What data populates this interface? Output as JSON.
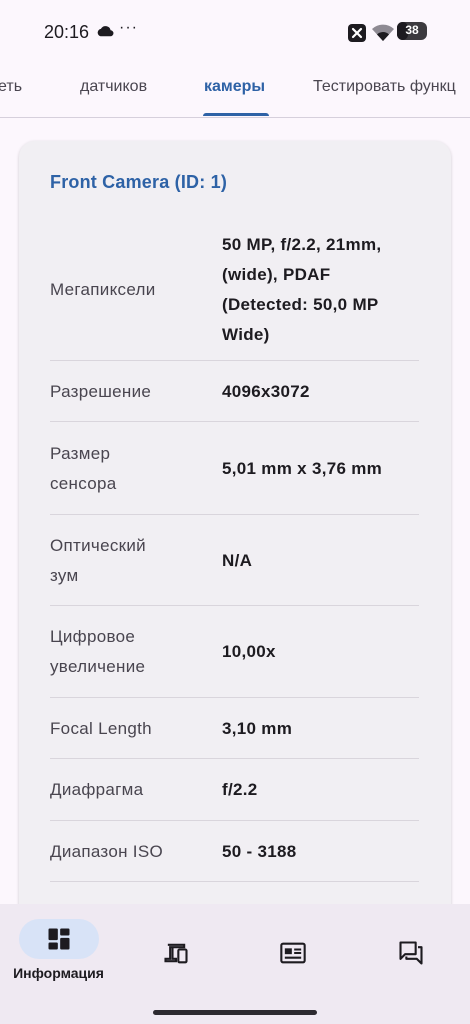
{
  "status_bar": {
    "time": "20:16",
    "dots": "···",
    "battery": "38",
    "battery_level": 0.38,
    "icons": [
      "cloud-icon",
      "notification-x-icon",
      "wifi-icon",
      "battery-icon"
    ]
  },
  "tabs": [
    {
      "label": "еть",
      "active": false
    },
    {
      "label": "датчиков",
      "active": false
    },
    {
      "label": "камеры",
      "active": true
    },
    {
      "label": "Тестировать функц",
      "active": false
    }
  ],
  "card": {
    "title": "Front Camera (ID: 1)",
    "rows": [
      {
        "label": [
          "Мегапиксели"
        ],
        "value": [
          "50 MP, f/2.2, 21mm,",
          "(wide), PDAF",
          "(Detected: 50,0 MP",
          "Wide)"
        ]
      },
      {
        "label": [
          "Разрешение"
        ],
        "value": [
          "4096x3072"
        ]
      },
      {
        "label": [
          "Размер",
          "сенсора"
        ],
        "value": [
          "5,01 mm x 3,76 mm"
        ]
      },
      {
        "label": [
          "Оптический",
          "зум"
        ],
        "value": [
          "N/A"
        ]
      },
      {
        "label": [
          "Цифровое",
          "увеличение"
        ],
        "value": [
          "10,00x"
        ]
      },
      {
        "label": [
          "Focal Length"
        ],
        "value": [
          "3,10 mm"
        ]
      },
      {
        "label": [
          "Диафрагма"
        ],
        "value": [
          "f/2.2"
        ]
      },
      {
        "label": [
          "Диапазон ISO"
        ],
        "value": [
          "50 - 3188"
        ]
      }
    ]
  },
  "bottom_nav": {
    "items": [
      {
        "icon": "dashboard-icon",
        "label": "Информация",
        "active": true
      },
      {
        "icon": "devices-icon",
        "label": "",
        "active": false
      },
      {
        "icon": "newspaper-icon",
        "label": "",
        "active": false
      },
      {
        "icon": "forum-icon",
        "label": "",
        "active": false
      }
    ]
  },
  "colors": {
    "accent": "#2e62a6",
    "background": "#fcf7fd",
    "card": "#f1eff3",
    "nav_background": "#efe9f2",
    "nav_pill": "#d8e3f7"
  }
}
